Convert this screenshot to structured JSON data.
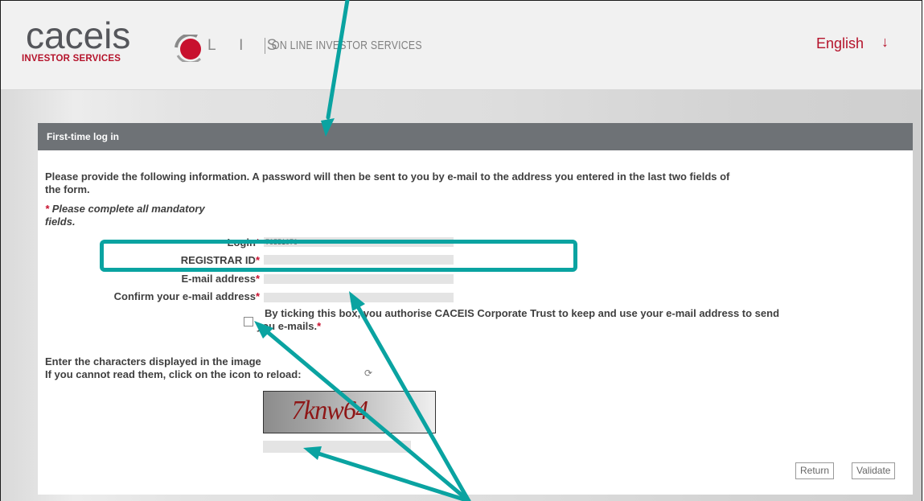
{
  "header": {
    "brand_name": "caceis",
    "brand_sub": "INVESTOR SERVICES",
    "product_letters": "L I S",
    "product_tagline": "ON LINE INVESTOR SERVICES",
    "language": "English",
    "language_arrow": "↓"
  },
  "panel": {
    "title": "First-time log in",
    "intro_line1": "Please provide the following information. A password will then be sent to you by e-mail to the address you entered in the last two fields of",
    "intro_line2": "the form.",
    "mandatory_star": "*",
    "mandatory_line1": "Please complete all mandatory",
    "mandatory_line2": "fields."
  },
  "form": {
    "login_label": "Login",
    "login_value": "70551070",
    "registrar_label": "REGISTRAR ID",
    "email_label": "E-mail address",
    "confirm_label": "Confirm your e-mail address",
    "required_marker": "*",
    "consent_line1": "By ticking this box, you authorise CACEIS Corporate Trust to keep and use your e-mail address to send",
    "consent_line2": "you e-mails.",
    "captcha_instruction1": "Enter the characters displayed in the image",
    "captcha_instruction2": "If you cannot read them, click on the icon to reload:",
    "reload_icon": "⟳",
    "captcha_text": "7knw64"
  },
  "buttons": {
    "return_label": "Return",
    "validate_label": "Validate"
  },
  "colors": {
    "brand_red": "#b5132b",
    "panel_header": "#6e7276",
    "annotation_teal": "#0aa3a1"
  }
}
